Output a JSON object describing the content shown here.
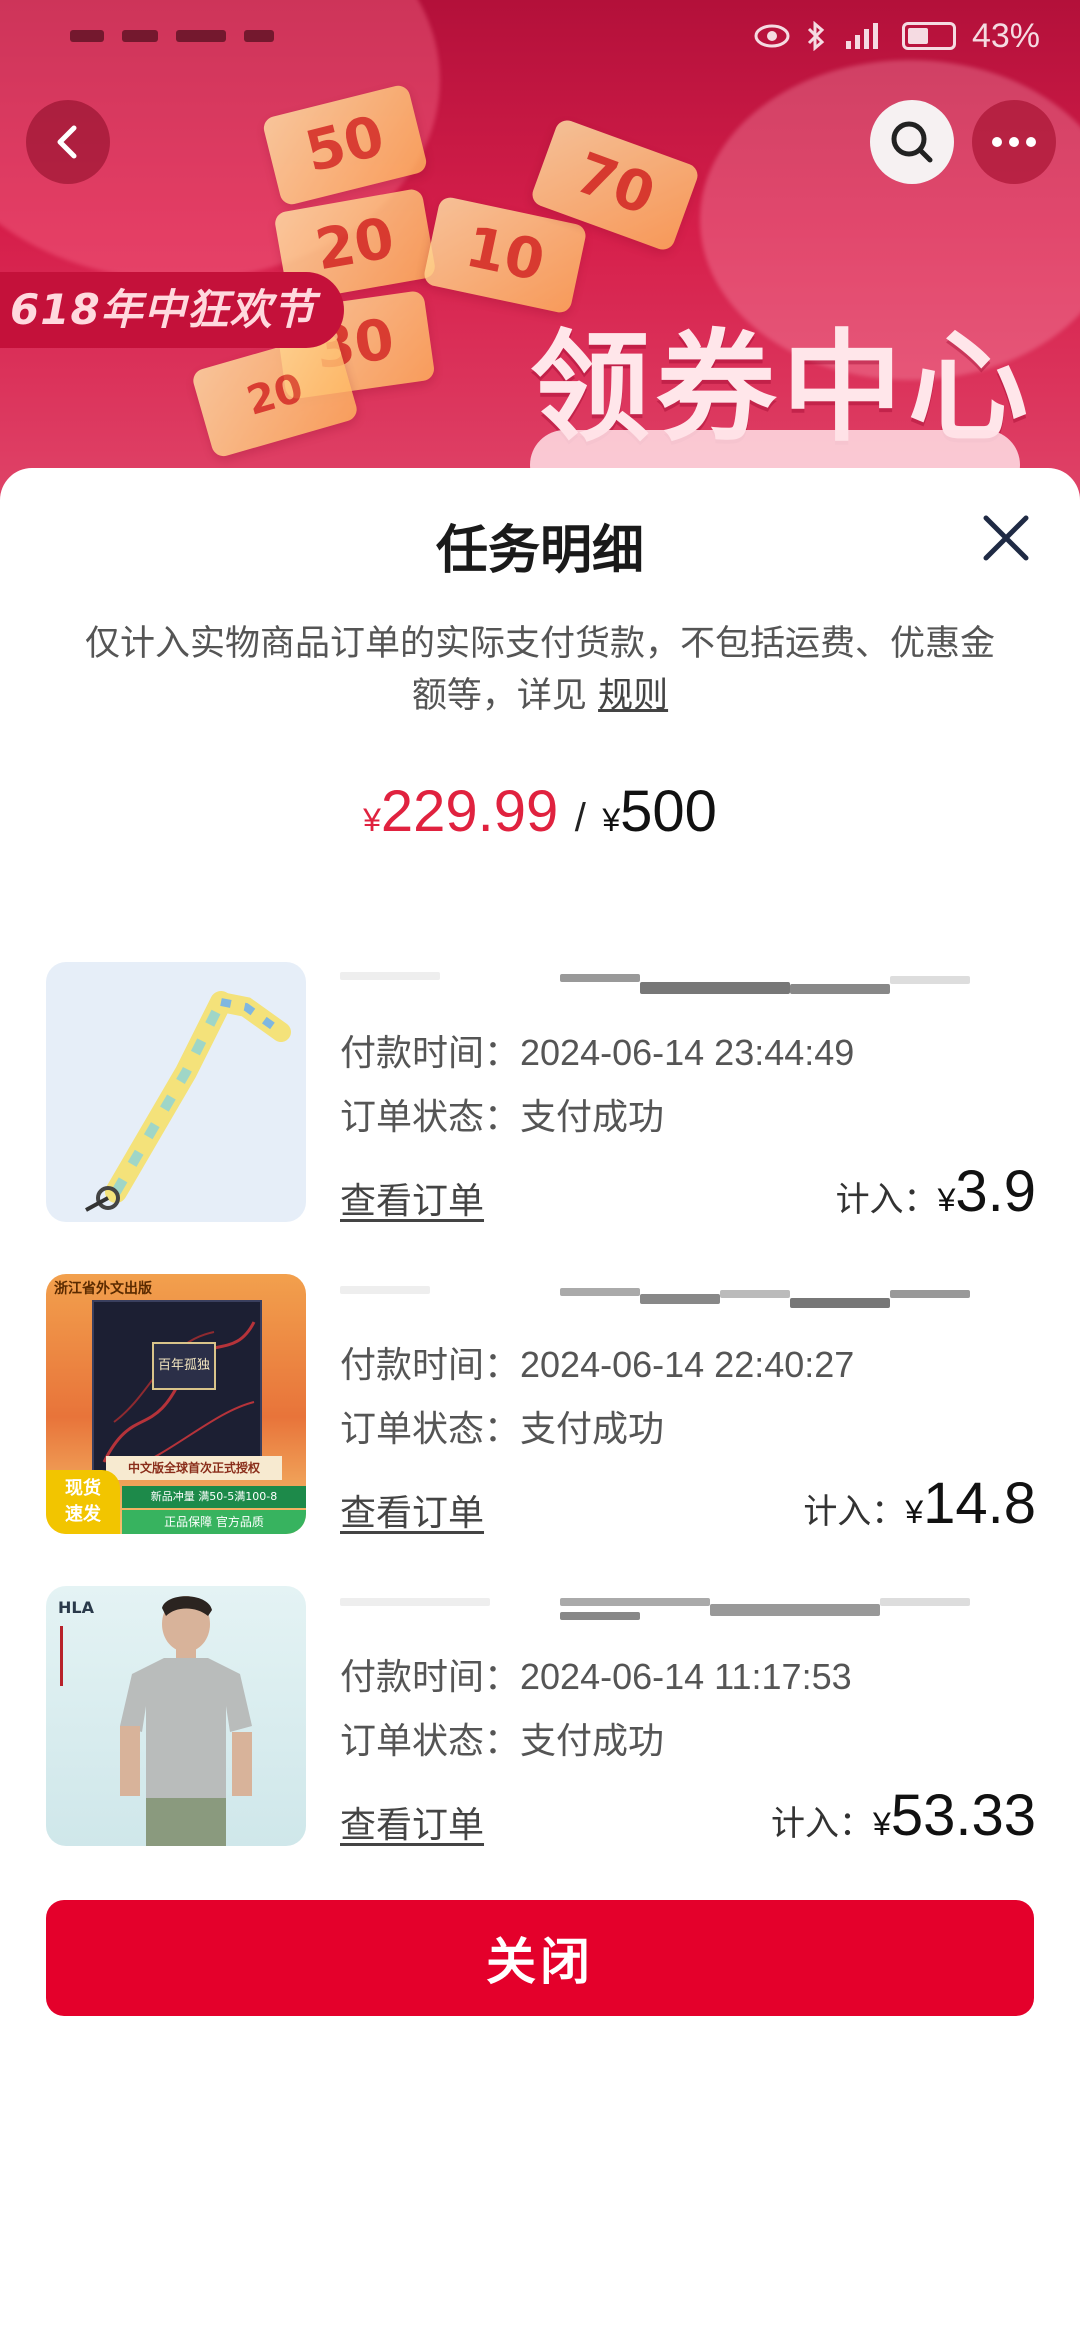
{
  "status_bar": {
    "battery": "43%"
  },
  "banner": {
    "festival_label": "618年中狂欢节",
    "center_title": "领券中心",
    "tickets": [
      "50",
      "20",
      "10",
      "30",
      "20",
      "70"
    ]
  },
  "sheet": {
    "title": "任务明细",
    "note_main": "仅计入实物商品订单的实际支付货款，不包括运费、优惠金额等，详见",
    "note_link": "规则",
    "progress": {
      "currency": "¥",
      "current": "229.99",
      "separator": "/",
      "target": "500"
    },
    "pay_time_label": "付款时间：",
    "status_label": "订单状态：",
    "view_label": "查看订单",
    "credit_label": "计入：",
    "orders": [
      {
        "pay_time": "2024-06-14 23:44:49",
        "status": "支付成功",
        "credit": "3.9",
        "thumb": "lanyard"
      },
      {
        "pay_time": "2024-06-14 22:40:27",
        "status": "支付成功",
        "credit": "14.8",
        "thumb": "book"
      },
      {
        "pay_time": "2024-06-14 11:17:53",
        "status": "支付成功",
        "credit": "53.33",
        "thumb": "tshirt"
      }
    ],
    "book_cover": {
      "publisher": "浙江省外文出版",
      "title": "百年孤独",
      "band": "中文版全球首次正式授权",
      "badge": [
        "现货",
        "速发"
      ],
      "promo_top": "新品冲量 满50-5满100-8",
      "promo_bottom": "正品保障 官方品质"
    },
    "tshirt_brand": "HLA",
    "close_button": "关闭"
  },
  "colors": {
    "accent": "#e4002b",
    "price_red": "#e0223f",
    "banner_red": "#c4113a"
  }
}
